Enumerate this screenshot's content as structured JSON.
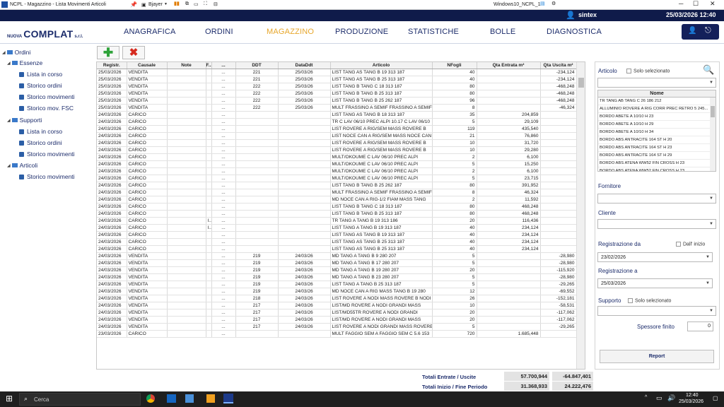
{
  "window": {
    "title": "NCPL - Magazzino - Lista Movimenti Articoli",
    "bjayer": "Bjayer",
    "remote": "Windows10_NCPL_1"
  },
  "topbar": {
    "user": "sintex",
    "datetime": "25/03/2026 12:40"
  },
  "logo": {
    "nuova": "NUOVA",
    "complat": "COMPLAT",
    "srl": "s.r.l."
  },
  "menu": [
    "ANAGRAFICA",
    "ORDINI",
    "MAGAZZINO",
    "PRODUZIONE",
    "STATISTICHE",
    "BOLLE",
    "DIAGNOSTICA"
  ],
  "tree": {
    "ordini": "Ordini",
    "essenze": "Essenze",
    "lista_in_corso": "Lista in corso",
    "storico_ordini": "Storico ordini",
    "storico_movimenti": "Storico movimenti",
    "storico_fsc": "Storico mov. FSC",
    "supporti": "Supporti",
    "lista_in_corso2": "Lista in corso",
    "storico_ordini2": "Storico ordini",
    "storico_movimenti2": "Storico movimenti",
    "articoli": "Articoli",
    "storico_movimenti3": "Storico movimenti"
  },
  "columns": [
    "Registr.",
    "Causale",
    "Note",
    "F...",
    "...",
    "DDT",
    "DataDdt",
    "Articolo",
    "NFogli",
    "Qta Entrata m²",
    "Qta Uscita m²"
  ],
  "rows": [
    [
      "25/03/2026",
      "VENDITA",
      "",
      "",
      "...",
      "221",
      "25/03/26",
      "LIST TANG AS TANG B 19 313 187",
      "40",
      "",
      "-234,124"
    ],
    [
      "25/03/2026",
      "VENDITA",
      "",
      "",
      "...",
      "221",
      "25/03/26",
      "LIST TANG AS TANG B 25 313 187",
      "40",
      "",
      "-234,124"
    ],
    [
      "25/03/2026",
      "VENDITA",
      "",
      "",
      "...",
      "222",
      "25/03/26",
      "LIST TANG B TANG C 18 313 187",
      "80",
      "",
      "-468,248"
    ],
    [
      "25/03/2026",
      "VENDITA",
      "",
      "",
      "...",
      "222",
      "25/03/26",
      "LIST TANG B TANG B 25 313 187",
      "80",
      "",
      "-468,248"
    ],
    [
      "25/03/2026",
      "VENDITA",
      "",
      "",
      "...",
      "222",
      "25/03/26",
      "LIST TANG B TANG B 25 262 187",
      "96",
      "",
      "-468,248"
    ],
    [
      "25/03/2026",
      "VENDITA",
      "",
      "",
      "...",
      "222",
      "25/03/26",
      "MULT FRASSINO A SEMIF FRASSINO A SEMIF",
      "8",
      "",
      "-46,324"
    ],
    [
      "24/03/2026",
      "CARICO",
      "",
      "",
      "...",
      "",
      "",
      "LIST TANG AS TANG B 18 313 187",
      "35",
      "204,859",
      ""
    ],
    [
      "24/03/2026",
      "CARICO",
      "",
      "",
      "...",
      "",
      "",
      "TR C LAV 06/10 PREC ALPI 10.17 C LAV 06/10",
      "5",
      "29,109",
      ""
    ],
    [
      "24/03/2026",
      "CARICO",
      "",
      "",
      "...",
      "",
      "",
      "LIST ROVERE A RIG/SEM MASS ROVERE B",
      "119",
      "435,540",
      ""
    ],
    [
      "24/03/2026",
      "CARICO",
      "",
      "",
      "...",
      "",
      "",
      "LIST NOCE CAN A RIG/SEM MASS NOCE CAN",
      "21",
      "76,860",
      ""
    ],
    [
      "24/03/2026",
      "CARICO",
      "",
      "",
      "...",
      "",
      "",
      "LIST ROVERE A RIG/SEM MASS ROVERE B",
      "10",
      "31,720",
      ""
    ],
    [
      "24/03/2026",
      "CARICO",
      "",
      "",
      "...",
      "",
      "",
      "LIST ROVERE A RIG/SEM MASS ROVERE B",
      "10",
      "29,280",
      ""
    ],
    [
      "24/03/2026",
      "CARICO",
      "",
      "",
      "...",
      "",
      "",
      "MULT/OKOUME C LAV 06/10 PREC ALPI",
      "2",
      "6,100",
      ""
    ],
    [
      "24/03/2026",
      "CARICO",
      "",
      "",
      "...",
      "",
      "",
      "MULT/OKOUME C LAV 06/10 PREC ALPI",
      "5",
      "15,250",
      ""
    ],
    [
      "24/03/2026",
      "CARICO",
      "",
      "",
      "...",
      "",
      "",
      "MULT/OKOUME C LAV 06/10 PREC ALPI",
      "2",
      "6,100",
      ""
    ],
    [
      "24/03/2026",
      "CARICO",
      "",
      "",
      "...",
      "",
      "",
      "MULT/OKOUME C LAV 06/10 PREC ALPI",
      "5",
      "23,715",
      ""
    ],
    [
      "24/03/2026",
      "CARICO",
      "",
      "",
      "...",
      "",
      "",
      "LIST TANG B TANG B 25 262 187",
      "80",
      "391,952",
      ""
    ],
    [
      "24/03/2026",
      "CARICO",
      "",
      "",
      "...",
      "",
      "",
      "MULT FRASSINO A SEMIF FRASSINO A SEMIF",
      "8",
      "46,324",
      ""
    ],
    [
      "24/03/2026",
      "CARICO",
      "",
      "",
      "...",
      "",
      "",
      "MD NOCE CAN A RIG-1/2 FIAM MASS TANG",
      "2",
      "11,592",
      ""
    ],
    [
      "24/03/2026",
      "CARICO",
      "",
      "",
      "...",
      "",
      "",
      "LIST TANG B TANG C 18 313 187",
      "80",
      "468,248",
      ""
    ],
    [
      "24/03/2026",
      "CARICO",
      "",
      "",
      "...",
      "",
      "",
      "LIST TANG B TANG B 25 313 187",
      "80",
      "468,248",
      ""
    ],
    [
      "24/03/2026",
      "CARICO",
      "",
      "I...",
      "...",
      "",
      "",
      "TR TANG A TANG B 19 313 186",
      "20",
      "116,436",
      ""
    ],
    [
      "24/03/2026",
      "CARICO",
      "",
      "I...",
      "...",
      "",
      "",
      "LIST TANG A TANG B 19 313 187",
      "40",
      "234,124",
      ""
    ],
    [
      "24/03/2026",
      "CARICO",
      "",
      "",
      "...",
      "",
      "",
      "LIST TANG AS TANG B 19 313 187",
      "40",
      "234,124",
      ""
    ],
    [
      "24/03/2026",
      "CARICO",
      "",
      "",
      "...",
      "",
      "",
      "LIST TANG AS TANG B 25 313 187",
      "40",
      "234,124",
      ""
    ],
    [
      "24/03/2026",
      "CARICO",
      "",
      "",
      "...",
      "",
      "",
      "LIST TANG AS TANG B 25 313 187",
      "40",
      "234,124",
      ""
    ],
    [
      "24/03/2026",
      "VENDITA",
      "",
      "",
      "...",
      "219",
      "24/03/26",
      "MD TANG A TANG B 9 280 207",
      "5",
      "",
      "-28,980"
    ],
    [
      "24/03/2026",
      "VENDITA",
      "",
      "",
      "...",
      "219",
      "24/03/26",
      "MD TANG A TANG B 17 280 207",
      "5",
      "",
      "-28,980"
    ],
    [
      "24/03/2026",
      "VENDITA",
      "",
      "",
      "...",
      "219",
      "24/03/26",
      "MD TANG A TANG B 19 280 207",
      "20",
      "",
      "-115,920"
    ],
    [
      "24/03/2026",
      "VENDITA",
      "",
      "",
      "...",
      "219",
      "24/03/26",
      "MD TANG A TANG B 23 280 207",
      "5",
      "",
      "-28,980"
    ],
    [
      "24/03/2026",
      "VENDITA",
      "",
      "",
      "...",
      "219",
      "24/03/26",
      "LIST TANG A TANG B 25 313 187",
      "5",
      "",
      "-29,265"
    ],
    [
      "24/03/2026",
      "VENDITA",
      "",
      "",
      "...",
      "219",
      "24/03/26",
      "MD NOCE CAN A RIG MASS TANG B 19 280",
      "12",
      "",
      "-69,552"
    ],
    [
      "24/03/2026",
      "VENDITA",
      "",
      "",
      "...",
      "218",
      "24/03/26",
      "LIST ROVERE A NODI MASS ROVERE B NODI",
      "26",
      "",
      "-152,181"
    ],
    [
      "24/03/2026",
      "VENDITA",
      "",
      "",
      "...",
      "217",
      "24/03/26",
      "LIST/MD ROVERE A NODI GRANDI MASS",
      "10",
      "",
      "-58,531"
    ],
    [
      "24/03/2026",
      "VENDITA",
      "",
      "",
      "...",
      "217",
      "24/03/26",
      "LIST/MD55TR ROVERE A NODI GRANDI",
      "20",
      "",
      "-117,062"
    ],
    [
      "24/03/2026",
      "VENDITA",
      "",
      "",
      "...",
      "217",
      "24/03/26",
      "LIST/MD ROVERE A NODI GRANDI MASS",
      "20",
      "",
      "-117,062"
    ],
    [
      "24/03/2026",
      "VENDITA",
      "",
      "",
      "...",
      "217",
      "24/03/26",
      "LIST ROVERE A NODI GRANDI MASS ROVERE",
      "5",
      "",
      "-29,265"
    ],
    [
      "23/03/2026",
      "CARICO",
      "",
      "",
      "...",
      "",
      "",
      "MULT FAGGIO SEM A FAGGIO SEM C 5.6 153",
      "720",
      "1.685,448",
      ""
    ]
  ],
  "totals": {
    "label1": "Totali Entrate / Uscite",
    "in1": "57.700,944",
    "out1": "-64.847,401",
    "label2": "Totali Inizio / Fine Periodo",
    "in2": "31.368,933",
    "out2": "24.222,476"
  },
  "filters": {
    "articolo": "Articolo",
    "solo_sel": "Solo selezionato",
    "nome": "Nome",
    "nomi": [
      "TR TANG AB TANG C 26 186 212",
      "ALLUMINIO ROVERE A RIG CORR PREC RETRO 5 245...",
      "BORDO ABETE A 10/10 H 23",
      "BORDO ABETE A 10/10 H 29",
      "BORDO ABETE A 10/10 H 34",
      "BORDO ABS ANTRACITE 164 ST H 20",
      "BORDO ABS ANTRACITE 164 ST H 23",
      "BORDO ABS ANTRACITE 164 ST H 29",
      "BORDO ABS ATENA WW52 FIN CROSS H 23",
      "BORDO ABS ATENA WW52 FIN CROSS H 23"
    ],
    "fornitore": "Fornitore",
    "cliente": "Cliente",
    "reg_da": "Registrazione da",
    "dall_inizio": "Dall' inizio",
    "date_da": "23/02/2026",
    "reg_a": "Registrazione a",
    "date_a": "25/03/2026",
    "supporto": "Supporto",
    "solo_sel2": "Solo selezionato",
    "spessore": "Spessore finito",
    "spessore_val": "0",
    "report": "Report"
  },
  "taskbar": {
    "search": "Cerca",
    "time": "12:40",
    "date": "25/03/2026"
  }
}
